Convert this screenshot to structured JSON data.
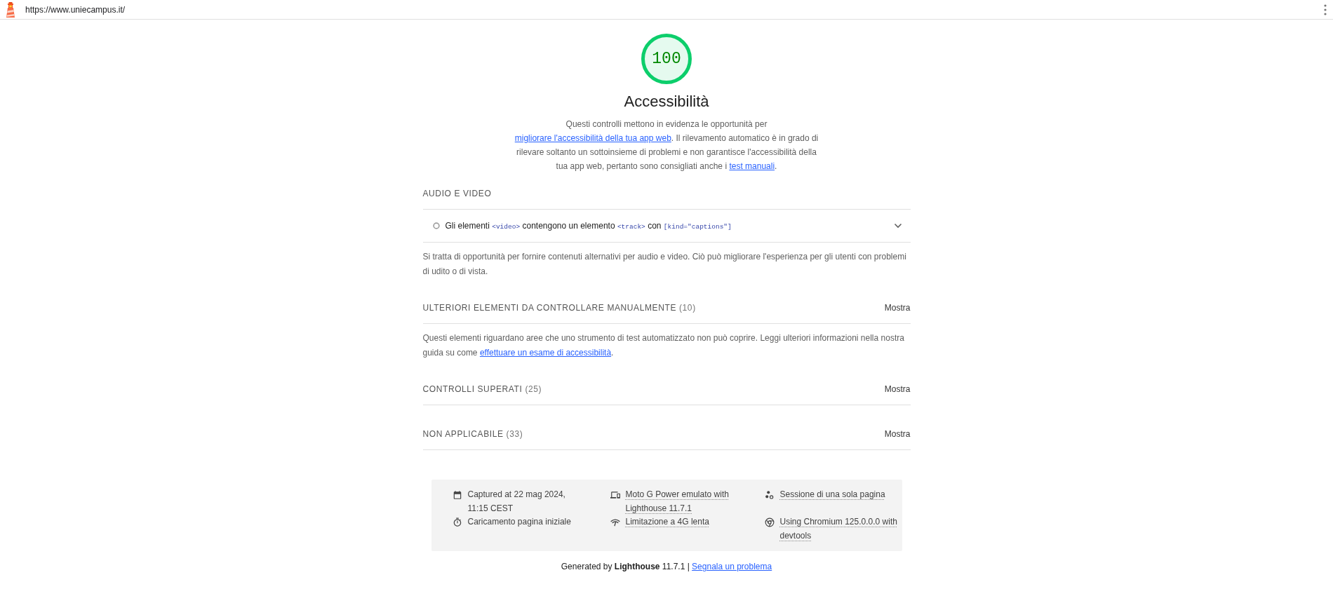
{
  "top_bar": {
    "url": "https://www.uniecampus.it/"
  },
  "header": {
    "gauge": {
      "score": "100"
    },
    "title": "Accessibilità",
    "description": [
      {
        "kind": "text",
        "text": "Questi controlli mettono in evidenza le opportunità per "
      },
      {
        "kind": "link",
        "text": "migliorare l'accessibilità della tua app web"
      },
      {
        "kind": "text",
        "text": ". Il rilevamento automatico è in grado di rilevare soltanto un sottoinsieme di problemi e non garantisce l'accessibilità della tua app web, pertanto sono consigliati anche i "
      },
      {
        "kind": "link",
        "text": "test manuali"
      },
      {
        "kind": "text",
        "text": "."
      }
    ]
  },
  "sections": [
    {
      "title": "AUDIO E VIDEO",
      "audits": [
        {
          "title": [
            {
              "kind": "text",
              "text": "Gli elementi "
            },
            {
              "kind": "code",
              "text": "<video>"
            },
            {
              "kind": "text",
              "text": " contengono un elemento "
            },
            {
              "kind": "code",
              "text": "<track>"
            },
            {
              "kind": "text",
              "text": " con "
            },
            {
              "kind": "code",
              "text": "[kind=\"captions\"]"
            }
          ],
          "expanded": false
        }
      ],
      "description": [
        {
          "kind": "text",
          "text": "Si tratta di opportunità per fornire contenuti alternativi per audio e video. Ciò può migliorare l'esperienza per gli utenti con problemi di udito o di vista."
        }
      ]
    },
    {
      "title": "ULTERIORI ELEMENTI DA CONTROLLARE MANUALMENTE",
      "count": "(10)",
      "toggle": "Mostra",
      "description": [
        {
          "kind": "text",
          "text": "Questi elementi riguardano aree che uno strumento di test automatizzato non può coprire. Leggi ulteriori informazioni nella nostra guida su come "
        },
        {
          "kind": "link",
          "text": "effettuare un esame di accessibilità"
        },
        {
          "kind": "text",
          "text": "."
        }
      ]
    },
    {
      "title": "CONTROLLI SUPERATI",
      "count": "(25)",
      "toggle": "Mostra"
    },
    {
      "title": "NON APPLICABILE",
      "count": "(33)",
      "toggle": "Mostra"
    }
  ],
  "environment": [
    {
      "text": "Captured at 22 mag 2024, 11:15 CEST",
      "underlined": false
    },
    {
      "text": "Moto G Power emulato with Lighthouse 11.7.1",
      "underlined": true
    },
    {
      "text": "Sessione di una sola pagina",
      "underlined": true
    },
    {
      "text": "Caricamento pagina iniziale",
      "underlined": false
    },
    {
      "text": "Limitazione a 4G lenta",
      "underlined": true
    },
    {
      "text": "Using Chromium 125.0.0.0 with devtools",
      "underlined": true
    }
  ],
  "footer": [
    {
      "kind": "text",
      "text": "Generated by **Lighthouse** 11.7.1 | "
    },
    {
      "kind": "link",
      "text": "Segnala un problema"
    }
  ]
}
